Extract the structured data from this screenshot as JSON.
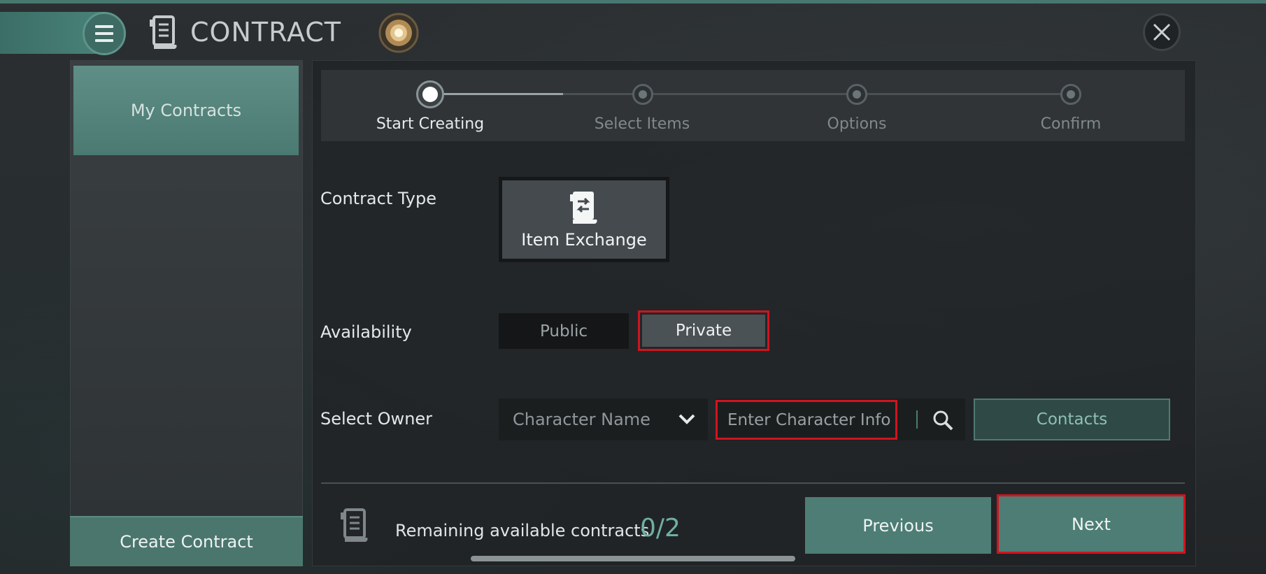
{
  "header": {
    "title": "CONTRACT",
    "menu_icon": "hamburger-icon",
    "contract_icon": "scroll-icon",
    "orb_icon": "orb-icon",
    "close_icon": "close-icon"
  },
  "sidebar": {
    "active_tab": "My Contracts",
    "create_button": "Create Contract"
  },
  "stepper": {
    "steps": [
      "Start Creating",
      "Select Items",
      "Options",
      "Confirm"
    ],
    "active_index": 0
  },
  "form": {
    "contract_type_label": "Contract Type",
    "contract_type_option": "Item Exchange",
    "availability_label": "Availability",
    "availability_options": [
      "Public",
      "Private"
    ],
    "availability_selected": "Private",
    "owner_label": "Select Owner",
    "owner_select_value": "Character Name",
    "owner_input_placeholder": "Enter Character Info",
    "contacts_button": "Contacts"
  },
  "footer": {
    "remaining_label": "Remaining available contracts",
    "remaining_count": "0/2",
    "previous_button": "Previous",
    "next_button": "Next"
  },
  "colors": {
    "accent_teal": "#4d7d75",
    "highlight_red": "#d0141e",
    "count_teal": "#6fb0a4"
  }
}
